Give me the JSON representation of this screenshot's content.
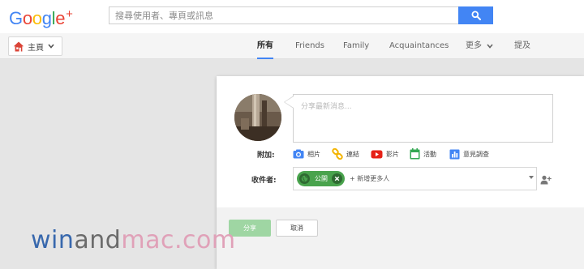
{
  "header": {
    "logo": {
      "letters": [
        "G",
        "o",
        "o",
        "g",
        "l",
        "e"
      ],
      "plus": "+"
    },
    "search": {
      "placeholder": "搜尋使用者、專頁或訊息",
      "value": ""
    }
  },
  "nav": {
    "home_label": "主頁",
    "tabs": [
      {
        "label": "所有",
        "active": true
      },
      {
        "label": "Friends",
        "active": false
      },
      {
        "label": "Family",
        "active": false
      },
      {
        "label": "Acquaintances",
        "active": false
      },
      {
        "label": "更多",
        "active": false
      },
      {
        "label": "提及",
        "active": false
      }
    ]
  },
  "share_box": {
    "status_placeholder": "分享最新消息...",
    "attach_label": "附加:",
    "attachments": [
      {
        "label": "相片",
        "icon": "camera-icon",
        "color": "#4285f4"
      },
      {
        "label": "連結",
        "icon": "link-icon",
        "color": "#f4b400"
      },
      {
        "label": "影片",
        "icon": "video-icon",
        "color": "#e62117"
      },
      {
        "label": "活動",
        "icon": "calendar-icon",
        "color": "#34a853"
      },
      {
        "label": "意見調查",
        "icon": "poll-icon",
        "color": "#4285f4"
      }
    ],
    "recipients_label": "收件者:",
    "public_chip": "公開",
    "add_people_text": "+ 新增更多人",
    "share_button": "分享",
    "cancel_button": "取消"
  },
  "watermark": {
    "part1": "win",
    "part2": "and",
    "part3": "mac.com"
  },
  "colors": {
    "accent": "#4285f4",
    "chip_green": "#49a34d",
    "share_green_disabled": "#9fd6a3",
    "logo": [
      "#4285f4",
      "#ea4335",
      "#fbbc05",
      "#4285f4",
      "#34a853",
      "#ea4335",
      "#ea4335"
    ]
  }
}
